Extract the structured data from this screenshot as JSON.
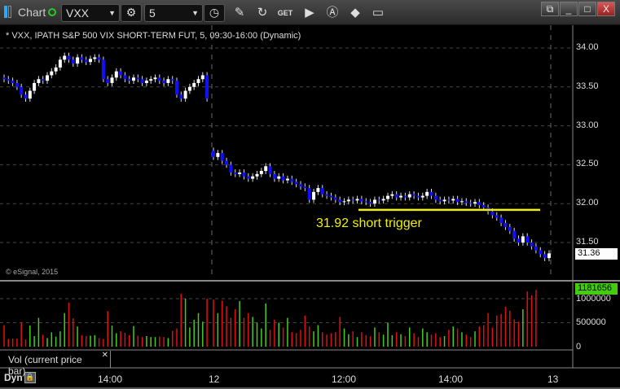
{
  "toolbar": {
    "app_label": "Chart",
    "symbol": "VXX",
    "interval": "5",
    "icons": [
      "settings-icon",
      "clock-icon",
      "pencil-icon",
      "refresh-icon",
      "get-icon",
      "play-icon",
      "alert-icon",
      "link-icon",
      "comment-icon"
    ]
  },
  "window_buttons": [
    "restore",
    "minimize",
    "maximize",
    "close"
  ],
  "chart": {
    "title": "* VXX, IPATH S&P 500 VIX SHORT-TERM FUT, 5, 09:30-16:00 (Dynamic)",
    "copyright": "© eSignal, 2015",
    "price_ticks": [
      "34.00",
      "33.50",
      "33.00",
      "32.50",
      "32.00",
      "31.50"
    ],
    "last_price": "31.36",
    "annotation": "31.92 short trigger",
    "trigger_level": 31.92,
    "colors": {
      "up": "#ffffff",
      "down": "#1010ff",
      "trigger": "#f0f000",
      "vol_up": "#44cc22",
      "vol_down": "#dd1111"
    },
    "closes_day1": [
      33.6,
      33.58,
      33.55,
      33.5,
      33.4,
      33.35,
      33.45,
      33.55,
      33.6,
      33.58,
      33.65,
      33.7,
      33.75,
      33.85,
      33.9,
      33.85,
      33.8,
      33.88,
      33.85,
      33.82,
      33.86,
      33.88,
      33.85,
      33.6,
      33.55,
      33.62,
      33.7,
      33.65,
      33.6,
      33.58,
      33.62,
      33.6,
      33.55,
      33.58,
      33.6,
      33.62,
      33.58,
      33.55,
      33.6,
      33.58,
      33.4,
      33.35,
      33.45,
      33.5,
      33.55,
      33.6,
      33.65,
      33.35
    ],
    "closes_day2": [
      32.6,
      32.65,
      32.55,
      32.5,
      32.4,
      32.38,
      32.4,
      32.35,
      32.32,
      32.35,
      32.38,
      32.42,
      32.48,
      32.38,
      32.32,
      32.35,
      32.3,
      32.32,
      32.28,
      32.25,
      32.22,
      32.2,
      32.05,
      32.15,
      32.2,
      32.12,
      32.1,
      32.08,
      32.05,
      32.02,
      32.03,
      32.05,
      32.04,
      32.06,
      32.03,
      32.02,
      32.0,
      32.05,
      32.04,
      32.06,
      32.1,
      32.12,
      32.08,
      32.1,
      32.08,
      32.12,
      32.1,
      32.08,
      32.1,
      32.15,
      32.1,
      32.05,
      32.03,
      32.05,
      32.04,
      32.06,
      32.02,
      32.03,
      32.01,
      32.0,
      32.02,
      31.98,
      31.95,
      31.9,
      31.85,
      31.82,
      31.75,
      31.7,
      31.65,
      31.55,
      31.5,
      31.58,
      31.5,
      31.45,
      31.4,
      31.35,
      31.3,
      31.36
    ]
  },
  "volume": {
    "label": "Vol (current price bar)",
    "last": "1181656",
    "ticks": [
      "1000000",
      "500000",
      "0"
    ],
    "values": [
      450000,
      160000,
      170000,
      170000,
      500000,
      150000,
      440000,
      220000,
      600000,
      250000,
      180000,
      300000,
      210000,
      320000,
      700000,
      920000,
      590000,
      420000,
      240000,
      220000,
      230000,
      240000,
      180000,
      160000,
      740000,
      440000,
      280000,
      320000,
      290000,
      240000,
      430000,
      230000,
      200000,
      220000,
      200000,
      200000,
      210000,
      200000,
      180000,
      330000,
      380000,
      1100000,
      1000000,
      400000,
      560000,
      700000,
      520000,
      1000000,
      980000,
      700000,
      960000,
      840000,
      600000,
      780000,
      950000,
      600000,
      700000,
      620000,
      500000,
      380000,
      900000,
      350000,
      560000,
      500000,
      400000,
      600000,
      300000,
      280000,
      350000,
      650000,
      420000,
      320000,
      450000,
      300000,
      250000,
      280000,
      300000,
      620000,
      380000,
      260000,
      320000,
      200000,
      300000,
      240000,
      220000,
      400000,
      300000,
      250000,
      500000,
      240000,
      300000,
      260000,
      220000,
      400000,
      280000,
      200000,
      380000,
      300000,
      250000,
      280000,
      200000,
      220000,
      350000,
      420000,
      380000,
      300000,
      250000,
      200000,
      320000,
      420000,
      450000,
      700000,
      400000,
      650000,
      680000,
      830000,
      750000,
      570000,
      520000,
      780000,
      1150000,
      1070000,
      1181656
    ]
  },
  "x_axis": {
    "labels": [
      "14:00",
      "12",
      "12:00",
      "14:00",
      "13"
    ]
  },
  "footer": {
    "dyn_label": "Dyn"
  }
}
